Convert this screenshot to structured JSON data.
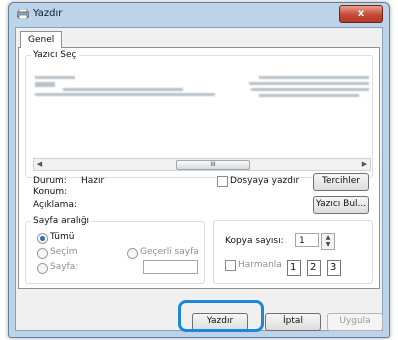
{
  "window": {
    "title": "Yazdır",
    "close_label": "x"
  },
  "tabs": [
    {
      "label": "Genel"
    }
  ],
  "printer_select": {
    "legend": "Yazıcı Seç",
    "scroll_thumb": "III",
    "status_label": "Durum:",
    "status_value": "Hazır",
    "location_label": "Konum:",
    "comment_label": "Açıklama:",
    "print_to_file_label": "Dosyaya yazdır",
    "preferences_button": "Tercihler",
    "find_printer_button": "Yazıcı Bul..."
  },
  "page_range": {
    "legend": "Sayfa aralığı",
    "all_label": "Tümü",
    "selection_label": "Seçim",
    "current_page_label": "Geçerli sayfa",
    "pages_label": "Sayfa:",
    "pages_value": "",
    "selected": "all"
  },
  "copies": {
    "count_label": "Kopya sayısı:",
    "count_value": "1",
    "collate_label": "Harmanla",
    "collate_pages": [
      "1",
      "1",
      "2",
      "2",
      "3",
      "3"
    ]
  },
  "footer": {
    "print_button": "Yazdır",
    "cancel_button": "İptal",
    "apply_button": "Uygula"
  },
  "colors": {
    "accent_highlight": "#1e88d6",
    "window_frame": "#bdd3ea",
    "close_button": "#c64a34"
  }
}
